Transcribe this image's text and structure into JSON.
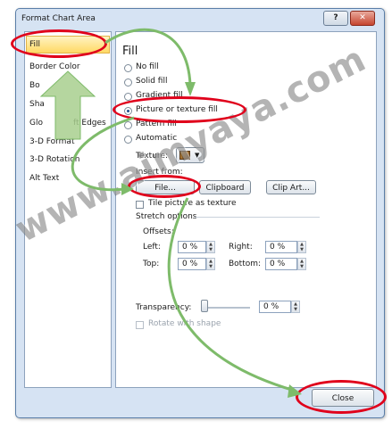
{
  "dialog": {
    "title": "Format Chart Area",
    "help_label": "?",
    "close_glyph": "✕",
    "close_button": "Close"
  },
  "nav": {
    "items": [
      "Fill",
      "Border Color",
      "Border Styles",
      "Shadow",
      "Glow and Soft Edges",
      "3-D Format",
      "3-D Rotation",
      "Alt Text"
    ],
    "visible_text": [
      "Fill",
      "Border Color",
      "Bo",
      "Sha",
      "Glo",
      "ft Edges",
      "3-D Format",
      "3-D Rotation",
      "Alt Text"
    ],
    "selected": "Fill"
  },
  "fill": {
    "section_title": "Fill",
    "options": [
      "No fill",
      "Solid fill",
      "Gradient fill",
      "Picture or texture fill",
      "Pattern fill",
      "Automatic"
    ],
    "selected_option": "Picture or texture fill",
    "texture_label": "Texture:",
    "insert_from_label": "Insert from:",
    "file_button": "File...",
    "clipboard_button": "Clipboard",
    "clip_art_button": "Clip Art...",
    "tile_label": "Tile picture as texture",
    "stretch_label": "Stretch options",
    "offsets_label": "Offsets:",
    "left_label": "Left:",
    "left_value": "0 %",
    "right_label": "Right:",
    "right_value": "0 %",
    "top_label": "Top:",
    "top_value": "0 %",
    "bottom_label": "Bottom:",
    "bottom_value": "0 %",
    "transparency_label": "Transparency:",
    "transparency_value": "0 %",
    "transparency_level": 0,
    "rotate_label": "Rotate with shape"
  },
  "watermark": "www.aimyaya.com",
  "colors": {
    "highlight": "#e0001b",
    "arrow_green": "#7ebb6a",
    "selected_bg": "#ffd965"
  }
}
